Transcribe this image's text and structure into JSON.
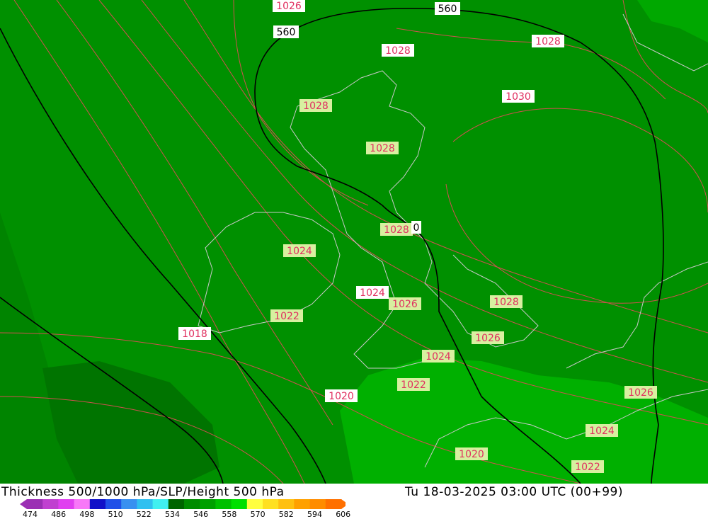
{
  "title_left": "Thickness 500/1000 hPa/SLP/Height 500 hPa",
  "title_right": "Tu 18-03-2025 03:00 UTC (00+99)",
  "isobar_labels": [
    "1026",
    "1028",
    "1028",
    "1030",
    "1028",
    "1028",
    "1028",
    "1024",
    "1024",
    "1026",
    "1028",
    "1022",
    "1018",
    "1026",
    "1024",
    "1022",
    "1020",
    "1026",
    "1024",
    "1020",
    "1022"
  ],
  "height_labels": [
    "560",
    "560",
    "560"
  ],
  "colorbar": {
    "ticks": [
      "474",
      "486",
      "498",
      "510",
      "522",
      "534",
      "546",
      "558",
      "570",
      "582",
      "594",
      "606"
    ],
    "colors": [
      "#9b2fb4",
      "#c040d0",
      "#e040f0",
      "#f878f8",
      "#1010c8",
      "#2050e8",
      "#3890f0",
      "#30c0f0",
      "#40f0f0",
      "#006400",
      "#008c00",
      "#00a000",
      "#00c000",
      "#00e000",
      "#ffff40",
      "#ffe020",
      "#ffc010",
      "#ffa000",
      "#ff8c00",
      "#ff7000"
    ]
  },
  "colors": {
    "background": "#008c00",
    "light_green": "#00b400",
    "dark_green": "#006e00",
    "isobar": "#e05050",
    "height_contour": "#000000",
    "coastline": "#c8c8c8",
    "label_fill": "#d8f0a0",
    "label_text": "#e03060"
  }
}
